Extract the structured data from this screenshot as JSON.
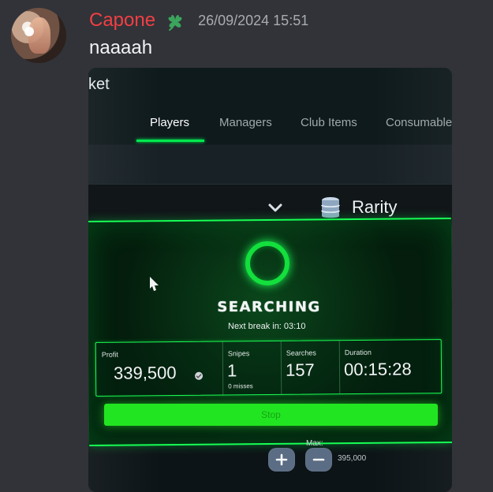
{
  "message": {
    "username": "Capone",
    "timestamp": "26/09/2024 15:51",
    "text": "naaaah"
  },
  "attachment": {
    "app_title": "ket",
    "tabs": [
      {
        "label": "Players"
      },
      {
        "label": "Managers"
      },
      {
        "label": "Club Items"
      },
      {
        "label": "Consumables"
      }
    ],
    "filter": {
      "label": "Rarity"
    },
    "status": {
      "title": "SEARCHING",
      "next_break": "Next break in: 03:10"
    },
    "stats": [
      {
        "label": "Profit",
        "value": "339,500",
        "sub": ""
      },
      {
        "label": "Snipes",
        "value": "1",
        "sub": "0 misses"
      },
      {
        "label": "Searches",
        "value": "157",
        "sub": ""
      },
      {
        "label": "Duration",
        "value": "00:15:28",
        "sub": ""
      }
    ],
    "stop_label": "Stop",
    "max": {
      "label": "Max:",
      "value": "395,000"
    }
  },
  "colors": {
    "username": "#f23f43",
    "accent_green": "#17ff55",
    "background": "#313338"
  },
  "icons": {
    "role": "clover-icon",
    "filter_toggle": "chevron-down-icon",
    "rarity": "database-icon",
    "cursor": "cursor-icon",
    "coin": "coin-icon",
    "increase": "plus-icon",
    "decrease": "minus-icon"
  }
}
